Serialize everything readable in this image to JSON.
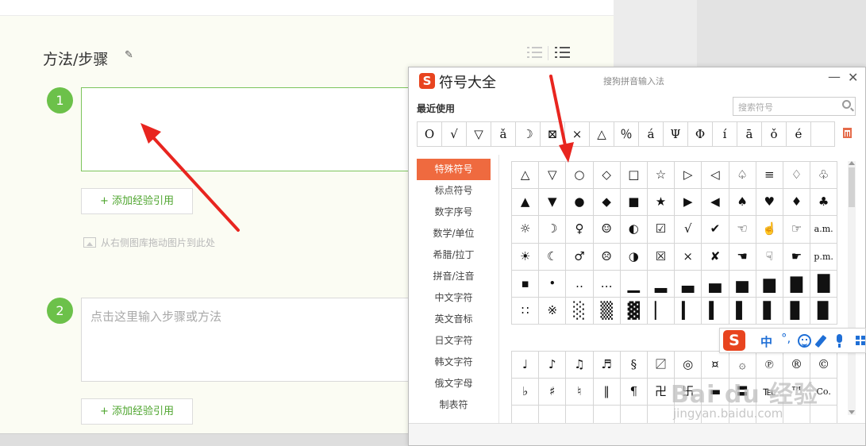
{
  "editor": {
    "section_title": "方法/步骤",
    "steps": [
      {
        "number": "1",
        "placeholder": ""
      },
      {
        "number": "2",
        "placeholder": "点击这里输入步骤或方法"
      }
    ],
    "add_reference_label": "+ 添加经验引用",
    "image_hint": "从右侧图库拖动图片到此处"
  },
  "symbol_panel": {
    "logo_text": "S",
    "title": "符号大全",
    "ime_name": "搜狗拼音输入法",
    "recent_label": "最近使用",
    "search_placeholder": "搜索符号",
    "recent_symbols": [
      "O",
      "√",
      "▽",
      "ǎ",
      "☽",
      "⊠",
      "×",
      "△",
      "％",
      "á",
      "Ψ",
      "Φ",
      "í",
      "ā",
      "ǒ",
      "é",
      ""
    ],
    "categories": [
      "特殊符号",
      "标点符号",
      "数字序号",
      "数学/单位",
      "希腊/拉丁",
      "拼音/注音",
      "中文字符",
      "英文音标",
      "日文字符",
      "韩文字符",
      "俄文字母",
      "制表符"
    ],
    "selected_category": "特殊符号",
    "grid_top": [
      [
        "△",
        "▽",
        "○",
        "◇",
        "□",
        "☆",
        "▷",
        "◁",
        "♤",
        "≡",
        "♢",
        "♧"
      ],
      [
        "▲",
        "▼",
        "●",
        "◆",
        "■",
        "★",
        "▶",
        "◀",
        "♠",
        "♥",
        "♦",
        "♣"
      ],
      [
        "☼",
        "☽",
        "♀",
        "☺",
        "◐",
        "☑",
        "√",
        "✔",
        "☜",
        "☝",
        "☞",
        "a.m."
      ],
      [
        "☀",
        "☾",
        "♂",
        "☹",
        "◑",
        "☒",
        "×",
        "✘",
        "☚",
        "☟",
        "☛",
        "p.m."
      ],
      [
        "▪",
        "•",
        "‥",
        "…",
        "▁",
        "▂",
        "▃",
        "▄",
        "▅",
        "▆",
        "▇",
        "█"
      ],
      [
        "∷",
        "※",
        "░",
        "▒",
        "▓",
        "▏",
        "▎",
        "▍",
        "▌",
        "▋",
        "▊",
        "▉"
      ]
    ],
    "grid_bottom": [
      [
        "♩",
        "♪",
        "♫",
        "♬",
        "§",
        "〼",
        "◎",
        "¤",
        "۞",
        "℗",
        "®",
        "©"
      ],
      [
        "♭",
        "♯",
        "♮",
        "‖",
        "¶",
        "卍",
        "卐",
        "▬",
        "〓",
        "℡",
        "™",
        "Co."
      ],
      [
        "",
        "",
        "",
        "",
        "",
        "",
        "",
        "",
        "",
        "",
        "",
        ""
      ]
    ]
  },
  "ime_bar": {
    "logo_text": "S",
    "mode": "中",
    "punct": "°,"
  },
  "watermark": {
    "line1": "Bai du 经验",
    "line2": "jingyan.baidu.com"
  },
  "colors": {
    "step_green": "#6cc14a",
    "sogou_orange": "#e8441f",
    "category_selected": "#ef6a3f",
    "arrow_red": "#e8251f",
    "ime_blue": "#1f6fd6"
  }
}
